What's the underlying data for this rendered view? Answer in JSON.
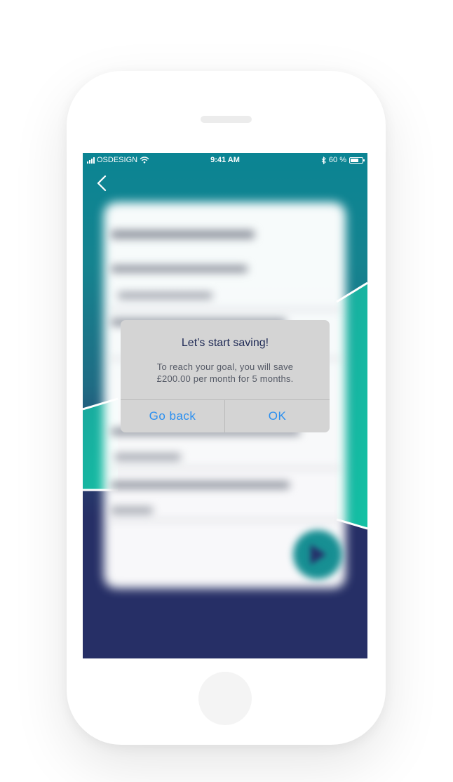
{
  "status_bar": {
    "carrier": "OSDESIGN",
    "time": "9:41 AM",
    "battery_percent": "60 %"
  },
  "dialog": {
    "title": "Let’s start saving!",
    "message_line1": "To reach your goal, you will save",
    "message_line2": "£200.00 per month for 5 months.",
    "left_button": "Go back",
    "right_button": "OK"
  },
  "colors": {
    "header_teal": "#0b8493",
    "navy": "#262f66",
    "accent_teal": "#17b39f",
    "dialog_bg": "#d4d4d4",
    "button_blue": "#2a8ff0"
  },
  "icons": {
    "back": "chevron-left-icon",
    "wifi": "wifi-icon",
    "bluetooth": "bluetooth-icon",
    "battery": "battery-icon",
    "signal": "signal-bars-icon",
    "next": "play-arrow-icon"
  }
}
